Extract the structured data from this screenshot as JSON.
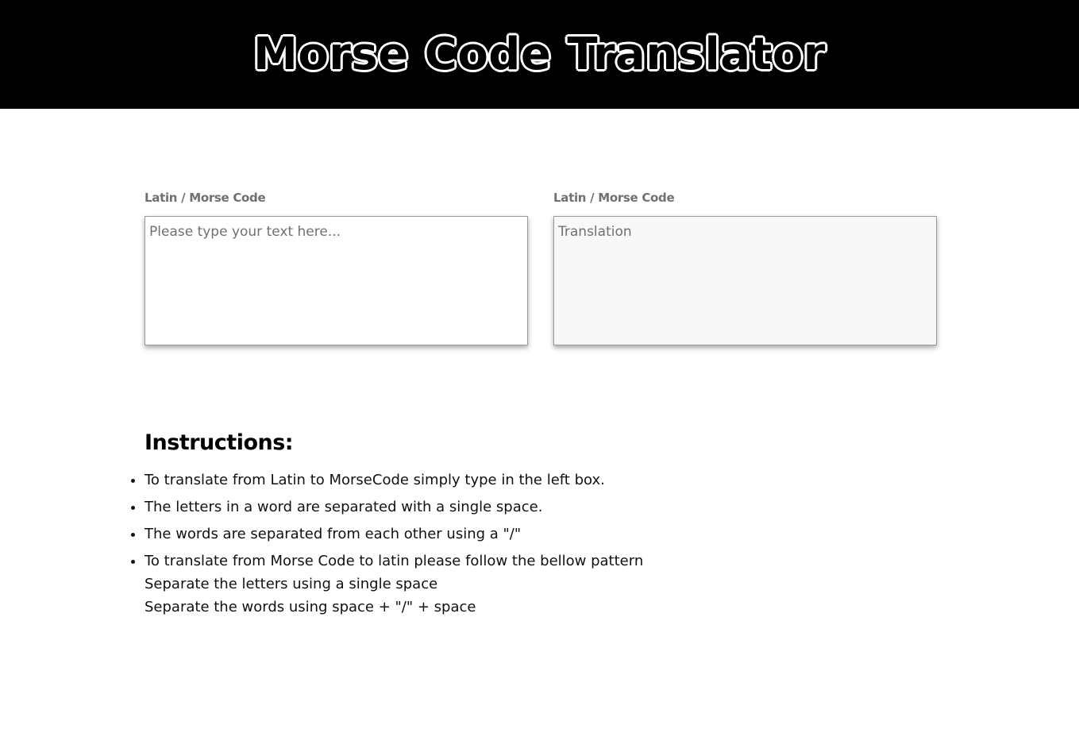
{
  "header": {
    "title": "Morse Code Translator"
  },
  "input_panel": {
    "label": "Latin / Morse Code",
    "placeholder": "Please type your text here...",
    "value": ""
  },
  "output_panel": {
    "label": "Latin / Morse Code",
    "placeholder": "Translation",
    "value": ""
  },
  "instructions": {
    "title": "Instructions:",
    "items": [
      "To translate from Latin to MorseCode simply type in the left box.",
      "The letters in a word are separated with a single space.",
      "The words are separated from each other using a \"/\"",
      "To translate from Morse Code to latin please follow the bellow pattern"
    ],
    "sub_lines": [
      "Separate the letters using a single space",
      "Separate the words using space + \"/\" + space"
    ]
  },
  "colors": {
    "header_bg": "#000000",
    "title_fill": "#000000",
    "title_outline": "#ffffff",
    "label_text": "#707070",
    "output_bg": "#f8f8f8"
  }
}
